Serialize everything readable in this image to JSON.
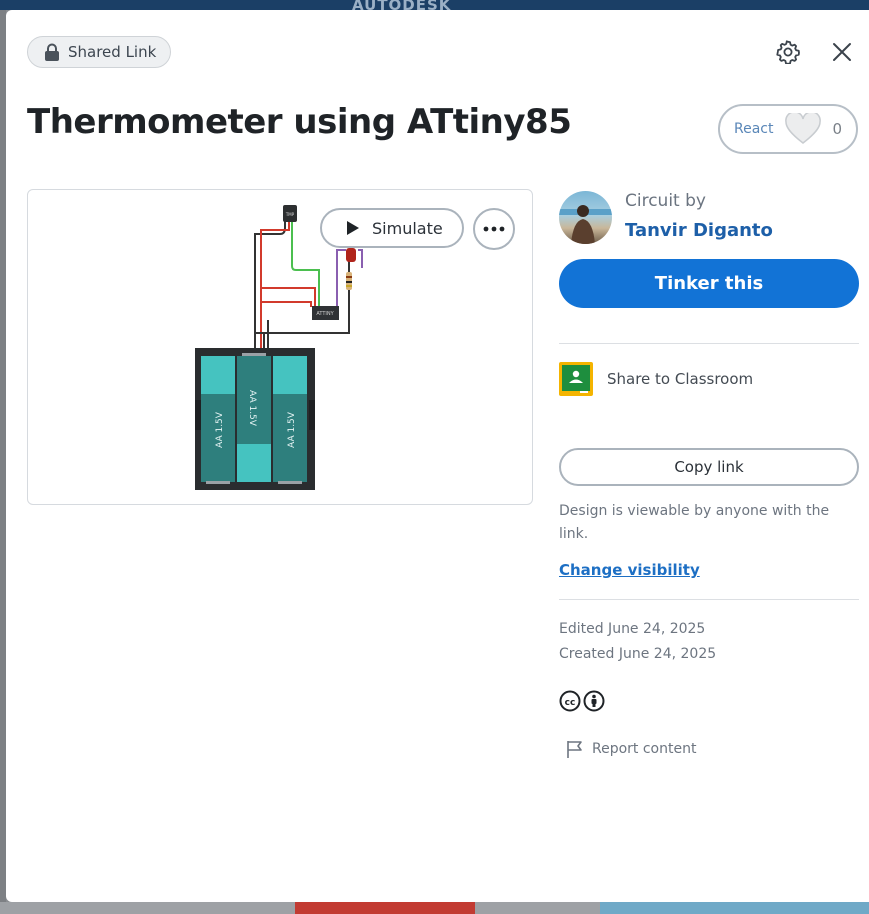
{
  "background": {
    "brand_text": "AUTODESK"
  },
  "modal": {
    "chip_label": "Shared Link",
    "title": "Thermometer using ATtiny85",
    "react": {
      "label": "React",
      "count": "0"
    },
    "canvas": {
      "simulate_label": "Simulate",
      "sensor_label": "TMP",
      "chip_label": "ATTINY",
      "battery_labels": [
        "AA 1.5V",
        "AA 1.5V",
        "AA 1.5V"
      ]
    },
    "author": {
      "prefix": "Circuit by",
      "name": "Tanvir Diganto"
    },
    "tinker_label": "Tinker this",
    "share_classroom_label": "Share to Classroom",
    "copy_link_label": "Copy link",
    "visibility_note": "Design is viewable by anyone with the link.",
    "change_visibility_label": "Change visibility",
    "edited": "Edited June 24, 2025",
    "created": "Created June 24, 2025",
    "report_label": "Report content"
  },
  "icons": [
    "lock-icon",
    "gear-icon",
    "close-icon",
    "heart-icon",
    "play-icon",
    "more-icon",
    "classroom-icon",
    "cc-icon",
    "attribution-icon",
    "flag-icon"
  ],
  "colors": {
    "primary": "#1273d6",
    "link": "#1d5fa8",
    "classroom_green": "#1e8e3e",
    "classroom_yellow": "#f4b400"
  }
}
